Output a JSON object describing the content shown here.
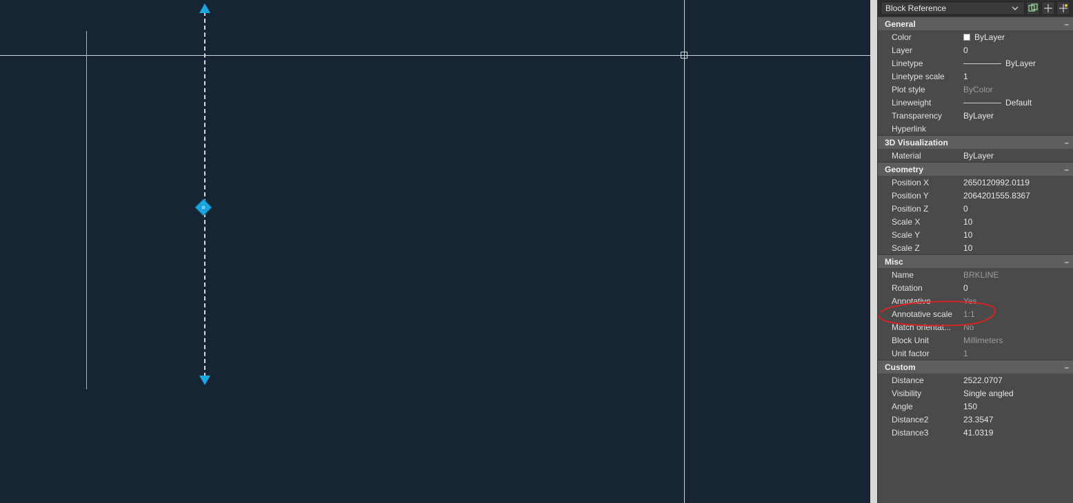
{
  "selector": {
    "value": "Block Reference"
  },
  "sections": {
    "general": {
      "title": "General",
      "rows": [
        {
          "label": "Color",
          "value": "ByLayer",
          "swatch": true
        },
        {
          "label": "Layer",
          "value": "0"
        },
        {
          "label": "Linetype",
          "value": "ByLayer",
          "line": true
        },
        {
          "label": "Linetype scale",
          "value": "1"
        },
        {
          "label": "Plot style",
          "value": "ByColor",
          "dim": true
        },
        {
          "label": "Lineweight",
          "value": "Default",
          "line": true
        },
        {
          "label": "Transparency",
          "value": "ByLayer"
        },
        {
          "label": "Hyperlink",
          "value": ""
        }
      ]
    },
    "viz": {
      "title": "3D Visualization",
      "rows": [
        {
          "label": "Material",
          "value": "ByLayer"
        }
      ]
    },
    "geometry": {
      "title": "Geometry",
      "rows": [
        {
          "label": "Position X",
          "value": "2650120992.0119"
        },
        {
          "label": "Position Y",
          "value": "2064201555.8367"
        },
        {
          "label": "Position Z",
          "value": "0"
        },
        {
          "label": "Scale X",
          "value": "10"
        },
        {
          "label": "Scale Y",
          "value": "10"
        },
        {
          "label": "Scale Z",
          "value": "10"
        }
      ]
    },
    "misc": {
      "title": "Misc",
      "rows": [
        {
          "label": "Name",
          "value": "BRKLINE",
          "dim": true
        },
        {
          "label": "Rotation",
          "value": "0"
        },
        {
          "label": "Annotative",
          "value": "Yes",
          "dim": true
        },
        {
          "label": "Annotative scale",
          "value": "1:1",
          "dim": true,
          "highlight": true
        },
        {
          "label": "Match  orientat...",
          "value": "No",
          "dim": true
        },
        {
          "label": "Block Unit",
          "value": "Millimeters",
          "dim": true
        },
        {
          "label": "Unit factor",
          "value": "1",
          "dim": true
        }
      ]
    },
    "custom": {
      "title": "Custom",
      "rows": [
        {
          "label": "Distance",
          "value": "2522.0707"
        },
        {
          "label": "Visibility",
          "value": "Single angled"
        },
        {
          "label": "Angle",
          "value": "150"
        },
        {
          "label": "Distance2",
          "value": "23.3547"
        },
        {
          "label": "Distance3",
          "value": "41.0319"
        }
      ]
    }
  }
}
